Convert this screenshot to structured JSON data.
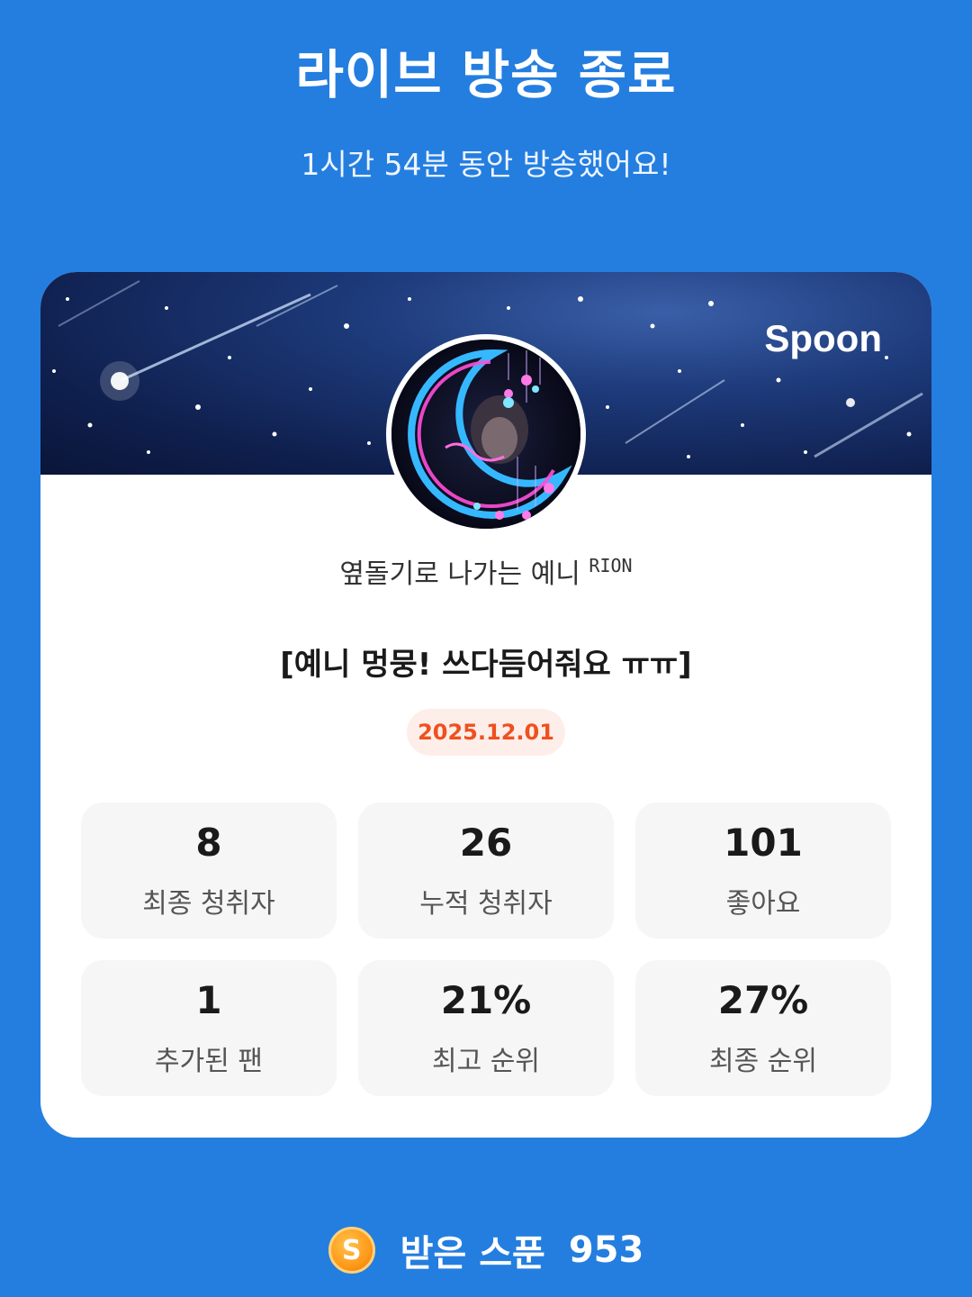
{
  "header": {
    "title": "라이브 방송 종료",
    "subtitle": "1시간 54분 동안 방송했어요!"
  },
  "card": {
    "brand": "Spoon",
    "nickname": "옆돌기로 나가는 예니",
    "nickname_suffix": "RION",
    "live_title": "[예니 멍뭉! 쓰다듬어줘요 ㅠㅠ]",
    "date": "2025.12.01",
    "stats": [
      {
        "value": "8",
        "label": "최종 청취자"
      },
      {
        "value": "26",
        "label": "누적 청취자"
      },
      {
        "value": "101",
        "label": "좋아요"
      },
      {
        "value": "1",
        "label": "추가된 팬"
      },
      {
        "value": "21%",
        "label": "최고 순위"
      },
      {
        "value": "27%",
        "label": "최종 순위"
      }
    ]
  },
  "footer": {
    "coin_letter": "S",
    "label": "받은 스푼",
    "value": "953"
  },
  "colors": {
    "background": "#247ee0",
    "date_text": "#f0501e",
    "date_bg": "#fdeee9",
    "stat_bg": "#f6f6f6"
  }
}
